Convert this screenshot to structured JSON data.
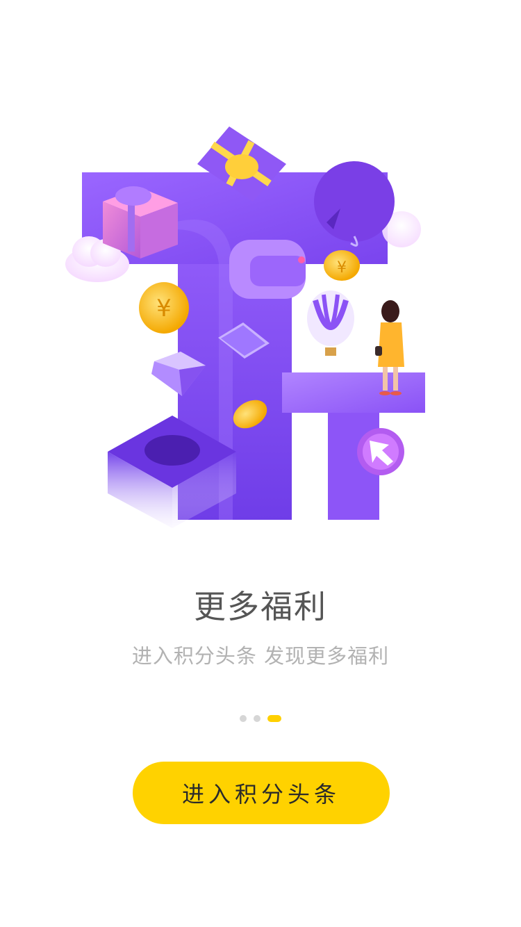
{
  "onboarding": {
    "title": "更多福利",
    "subtitle": "进入积分头条 发现更多福利",
    "page_dots": {
      "count": 3,
      "active_index": 2
    },
    "cta_label": "进入积分头条"
  },
  "illustration": {
    "coin_glyph": "¥",
    "colors": {
      "purple_main": "#8b52f5",
      "purple_dark": "#6a35e0",
      "purple_light": "#b48cff",
      "gold": "#ffc21a",
      "accent_yellow": "#ffd200",
      "title_gray": "#555555",
      "subtitle_gray": "#b2b2b2",
      "dot_inactive": "#d6d6d6"
    }
  }
}
